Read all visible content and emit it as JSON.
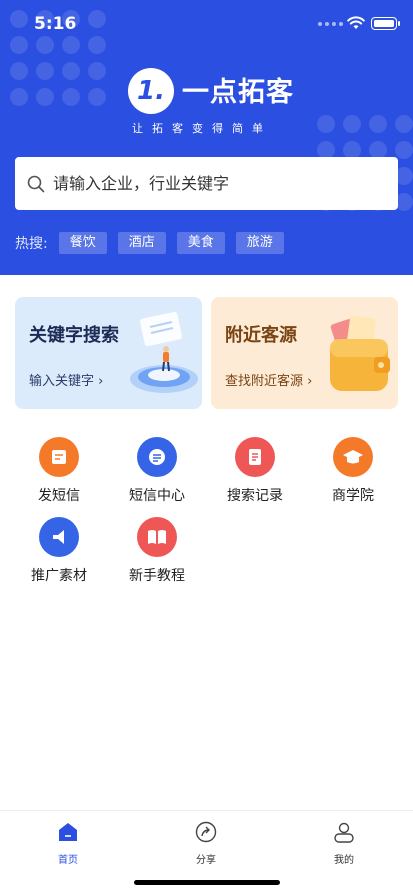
{
  "status_bar": {
    "time": "5:16"
  },
  "brand": {
    "logo_mark": "1.",
    "name": "一点拓客",
    "slogan": "让拓客变得简单"
  },
  "search": {
    "placeholder": "请输入企业，行业关键字"
  },
  "hot": {
    "label": "热搜:",
    "tags": [
      "餐饮",
      "酒店",
      "美食",
      "旅游"
    ]
  },
  "cards": {
    "keyword": {
      "title": "关键字搜索",
      "subtitle": "输入关键字 ›"
    },
    "nearby": {
      "title": "附近客源",
      "subtitle": "查找附近客源 ›"
    }
  },
  "grid": [
    {
      "label": "发短信",
      "icon": "sms-icon",
      "color": "#f47a2a"
    },
    {
      "label": "短信中心",
      "icon": "message-center-icon",
      "color": "#3565e6"
    },
    {
      "label": "搜索记录",
      "icon": "search-record-icon",
      "color": "#ef5757"
    },
    {
      "label": "商学院",
      "icon": "graduation-cap-icon",
      "color": "#f47a2a"
    },
    {
      "label": "推广素材",
      "icon": "megaphone-icon",
      "color": "#3565e6"
    },
    {
      "label": "新手教程",
      "icon": "book-icon",
      "color": "#ef5757"
    }
  ],
  "tabbar": {
    "items": [
      {
        "label": "首页",
        "icon": "home-icon",
        "active": true
      },
      {
        "label": "分享",
        "icon": "share-icon",
        "active": false
      },
      {
        "label": "我的",
        "icon": "user-icon",
        "active": false
      }
    ]
  },
  "colors": {
    "primary": "#2b4fe0",
    "orange": "#f47a2a",
    "red": "#ef5757"
  }
}
